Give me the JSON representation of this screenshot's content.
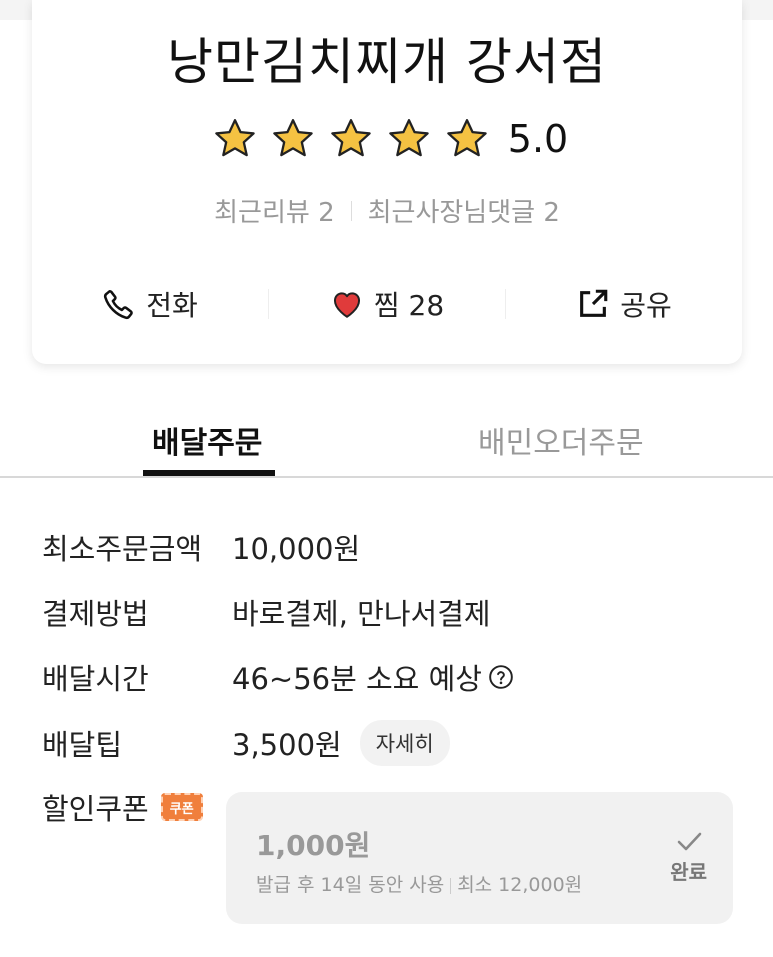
{
  "store": {
    "name": "낭만김치찌개 강서점",
    "rating": 5.0,
    "rating_text": "5.0",
    "stars_filled": 5,
    "recent_reviews_label": "최근리뷰 2",
    "recent_owner_replies_label": "최근사장님댓글 2"
  },
  "actions": {
    "call_label": "전화",
    "like_label": "찜 28",
    "share_label": "공유"
  },
  "tabs": {
    "delivery_label": "배달주문",
    "baemin_order_label": "배민오더주문",
    "active": "delivery"
  },
  "info": {
    "min_order": {
      "label": "최소주문금액",
      "value": "10,000원"
    },
    "payment": {
      "label": "결제방법",
      "value": "바로결제, 만나서결제"
    },
    "delivery_time": {
      "label": "배달시간",
      "value": "46~56분 소요 예상"
    },
    "delivery_tip": {
      "label": "배달팁",
      "value": "3,500원",
      "detail_button": "자세히"
    },
    "coupon": {
      "label": "할인쿠폰",
      "tag": "쿠폰",
      "amount": "1,000원",
      "issue_note": "발급 후 14일 동안 사용",
      "min_note": "최소 12,000원",
      "status_label": "완료"
    }
  },
  "colors": {
    "star": "#f5c242",
    "heart": "#e03b3b",
    "coupon_tag": "#f07f3c",
    "text_muted": "#999999"
  },
  "icons": {
    "rating": "star-icon",
    "call": "phone-icon",
    "like": "heart-icon",
    "share": "share-icon",
    "help": "question-circle-icon",
    "done": "check-icon"
  }
}
